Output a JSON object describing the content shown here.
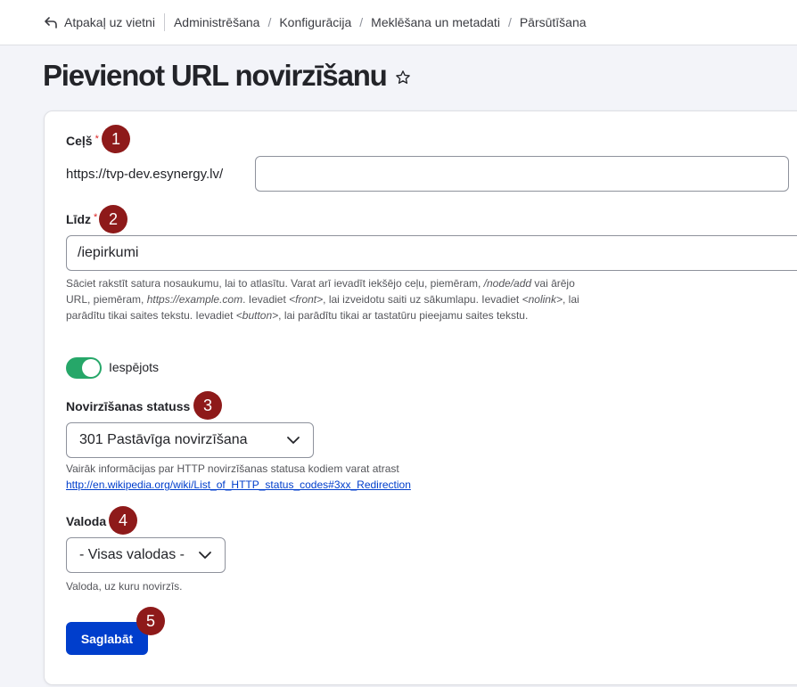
{
  "breadcrumb": {
    "back_label": "Atpakaļ uz vietni",
    "items": [
      "Administrēšana",
      "Konfigurācija",
      "Meklēšana un metadati",
      "Pārsūtīšana"
    ]
  },
  "page": {
    "title": "Pievienot URL novirzīšanu"
  },
  "form": {
    "path": {
      "label": "Ceļš",
      "required_mark": "*",
      "badge": "1",
      "prefix": "https://tvp-dev.esynergy.lv/",
      "value": ""
    },
    "to": {
      "label": "Līdz",
      "required_mark": "*",
      "badge": "2",
      "value": "/iepirkumi",
      "description": {
        "p1": "Sāciet rakstīt satura nosaukumu, lai to atlasītu. Varat arī ievadīt iekšējo ceļu, piemēram, ",
        "e1": "/node/add",
        "p2": " vai ārējo URL, piemēram, ",
        "e2": "https://example.com",
        "p3": ". Ievadiet ",
        "e3": "<front>",
        "p4": ", lai izveidotu saiti uz sākumlapu. Ievadiet ",
        "e4": "<nolink>",
        "p5": ", lai parādītu tikai saites tekstu. Ievadiet ",
        "e5": "<button>",
        "p6": ", lai parādītu tikai ar tastatūru pieejamu saites tekstu."
      }
    },
    "enabled": {
      "label": "Iespējots",
      "checked": true
    },
    "status": {
      "label": "Novirzīšanas statuss",
      "badge": "3",
      "value": "301 Pastāvīga novirzīšana",
      "description": "Vairāk informācijas par HTTP novirzīšanas statusa kodiem varat atrast",
      "link": "http://en.wikipedia.org/wiki/List_of_HTTP_status_codes#3xx_Redirection"
    },
    "language": {
      "label": "Valoda",
      "badge": "4",
      "value": "- Visas valodas -",
      "description": "Valoda, uz kuru novirzīs."
    },
    "save": {
      "label": "Saglabāt",
      "badge": "5"
    }
  },
  "colors": {
    "primary_button": "#003ecc",
    "toggle_on": "#26a769",
    "badge": "#8e1a1a",
    "required": "#dc2323",
    "link": "#003ecc"
  },
  "icons": {
    "back": "back-arrow-icon",
    "star": "star-outline-icon",
    "chevron": "chevron-down-icon"
  }
}
